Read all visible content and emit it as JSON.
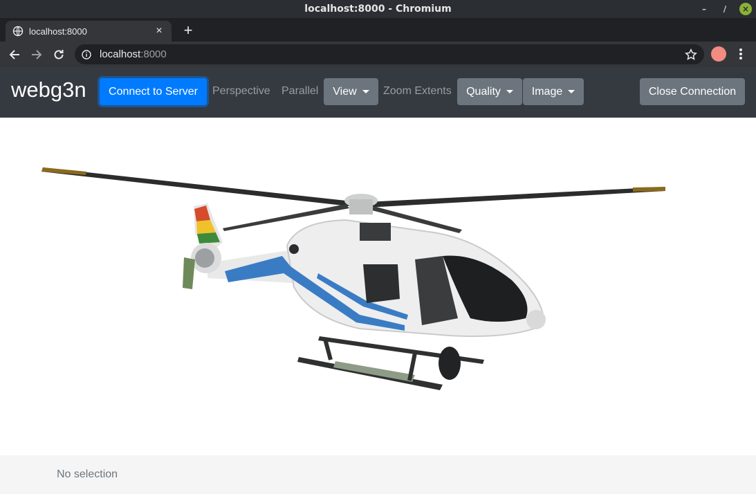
{
  "window": {
    "title": "localhost:8000 - Chromium"
  },
  "browser": {
    "tab_title": "localhost:8000",
    "url_host": "localhost",
    "url_port": ":8000"
  },
  "app": {
    "brand": "webg3n",
    "connect_label": "Connect to Server",
    "perspective_label": "Perspective",
    "parallel_label": "Parallel",
    "view_label": "View",
    "zoom_extents_label": "Zoom Extents",
    "quality_label": "Quality",
    "image_label": "Image",
    "close_connection_label": "Close Connection"
  },
  "footer": {
    "selection_text": "No selection"
  },
  "colors": {
    "navbar_bg": "#343a40",
    "primary": "#007bff",
    "secondary": "#6c757d",
    "footer_bg": "#f5f5f5"
  },
  "icons": {
    "tab": "globe-icon",
    "back": "arrow-left-icon",
    "forward": "arrow-right-icon",
    "reload": "reload-icon",
    "info": "info-icon",
    "bookmark": "star-icon",
    "menu": "kebab-menu-icon"
  }
}
